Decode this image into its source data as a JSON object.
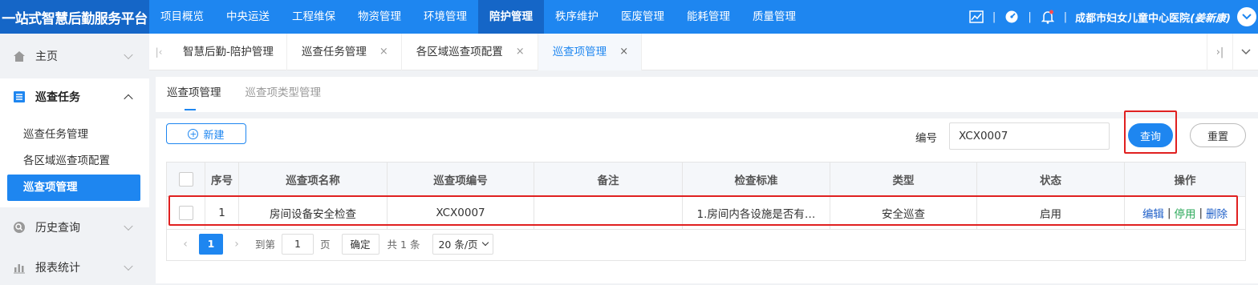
{
  "brand": "一站式智慧后勤服务平台",
  "nav": [
    "项目概览",
    "中央运送",
    "工程维保",
    "物资管理",
    "环境管理",
    "陪护管理",
    "秩序维护",
    "医废管理",
    "能耗管理",
    "质量管理"
  ],
  "nav_active": "陪护管理",
  "top_right": {
    "separator": "|",
    "hospital": "成都市妇女儿童中心医院",
    "user": "(姜新康)"
  },
  "sidebar": {
    "home": "主页",
    "inspection_task": "巡查任务",
    "sub_items": [
      "巡查任务管理",
      "各区域巡查项配置",
      "巡查项管理"
    ],
    "active_sub": "巡查项管理",
    "history": "历史查询",
    "reports": "报表统计"
  },
  "tabs": [
    "智慧后勤-陪护管理",
    "巡查任务管理",
    "各区域巡查项配置",
    "巡查项管理"
  ],
  "tab_close": "×",
  "subtabs": [
    "巡查项管理",
    "巡查项类型管理"
  ],
  "toolbar": {
    "new_label": "新建",
    "filter_label": "编号",
    "filter_value": "XCX0007",
    "query_label": "查询",
    "reset_label": "重置"
  },
  "table": {
    "headers": [
      "",
      "序号",
      "巡查项名称",
      "巡查项编号",
      "备注",
      "检查标准",
      "类型",
      "状态",
      "操作"
    ],
    "rows": [
      {
        "index": "1",
        "name": "房间设备安全检查",
        "code": "XCX0007",
        "remark": "",
        "standard": "1.房间内各设施是否有…",
        "type": "安全巡查",
        "status": "启用",
        "ops": [
          "编辑",
          "停用",
          "删除"
        ],
        "op_sep": "|"
      }
    ]
  },
  "pager": {
    "current": "1",
    "goto_prefix": "到第",
    "goto_value": "1",
    "goto_suffix": "页",
    "confirm": "确定",
    "total": "共 1 条",
    "page_size": "20 条/页"
  },
  "colors": {
    "primary": "#1e86f0",
    "brand_bg": "#1566c7",
    "highlight": "#e02020",
    "status": "#1e5fc8",
    "stop": "#2eaa5c"
  }
}
